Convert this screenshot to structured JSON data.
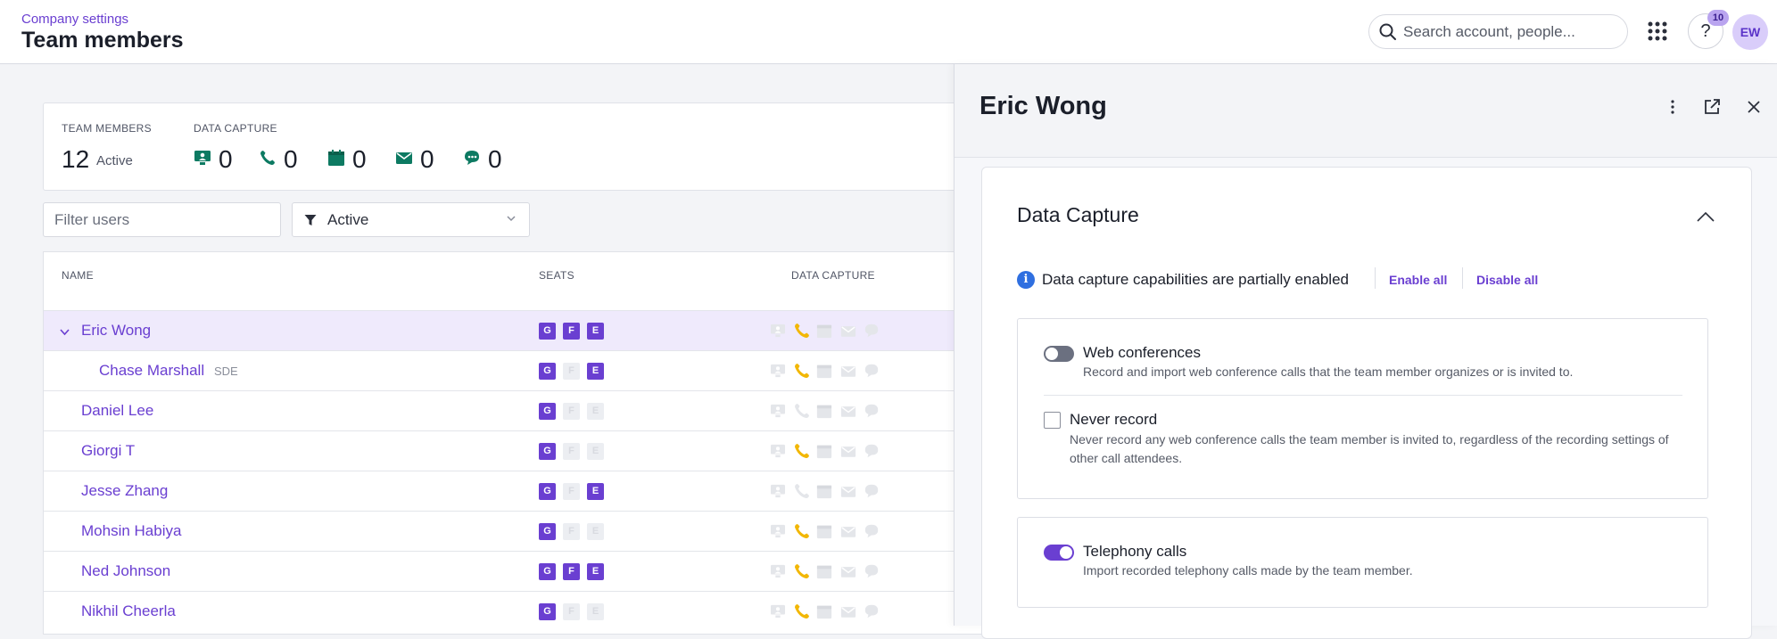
{
  "header": {
    "breadcrumb": "Company settings",
    "title": "Team members",
    "search_placeholder": "Search account, people...",
    "help_label": "?",
    "notification_count": "10",
    "avatar_initials": "EW"
  },
  "summary": {
    "team_members_label": "TEAM MEMBERS",
    "team_members_count": "12",
    "team_members_status": "Active",
    "data_capture_label": "DATA CAPTURE",
    "capture": [
      {
        "icon": "web-conference-icon",
        "count": "0"
      },
      {
        "icon": "phone-icon",
        "count": "0"
      },
      {
        "icon": "calendar-icon",
        "count": "0"
      },
      {
        "icon": "email-icon",
        "count": "0"
      },
      {
        "icon": "chat-icon",
        "count": "0"
      }
    ]
  },
  "filters": {
    "user_placeholder": "Filter users",
    "status_value": "Active"
  },
  "table": {
    "headers": {
      "name": "NAME",
      "seats": "SEATS",
      "data_capture": "DATA CAPTURE"
    },
    "rows": [
      {
        "name": "Eric Wong",
        "sub": "",
        "seats": [
          true,
          true,
          true
        ],
        "phone": true,
        "selected": true
      },
      {
        "name": "Chase Marshall",
        "sub": "SDE",
        "seats": [
          true,
          false,
          true
        ],
        "phone": true,
        "selected": false
      },
      {
        "name": "Daniel Lee",
        "sub": "",
        "seats": [
          true,
          false,
          false
        ],
        "phone": false,
        "selected": false
      },
      {
        "name": "Giorgi T",
        "sub": "",
        "seats": [
          true,
          false,
          false
        ],
        "phone": true,
        "selected": false
      },
      {
        "name": "Jesse Zhang",
        "sub": "",
        "seats": [
          true,
          false,
          true
        ],
        "phone": false,
        "selected": false
      },
      {
        "name": "Mohsin Habiya",
        "sub": "",
        "seats": [
          true,
          false,
          false
        ],
        "phone": true,
        "selected": false
      },
      {
        "name": "Ned Johnson",
        "sub": "",
        "seats": [
          true,
          true,
          true
        ],
        "phone": true,
        "selected": false
      },
      {
        "name": "Nikhil Cheerla",
        "sub": "",
        "seats": [
          true,
          false,
          false
        ],
        "phone": true,
        "selected": false
      }
    ],
    "seat_letters": [
      "G",
      "F",
      "E"
    ]
  },
  "panel": {
    "title": "Eric Wong",
    "section_title": "Data Capture",
    "info_text": "Data capture capabilities are partially enabled",
    "enable_all": "Enable all",
    "disable_all": "Disable all",
    "web_conferences": {
      "title": "Web conferences",
      "description": "Record and import web conference calls that the team member organizes or is invited to.",
      "enabled": false
    },
    "never_record": {
      "title": "Never record",
      "description": "Never record any web conference calls the team member is invited to, regardless of the recording settings of other call attendees.",
      "checked": false
    },
    "telephony": {
      "title": "Telephony calls",
      "description": "Import recorded telephony calls made by the team member.",
      "enabled": true
    }
  },
  "colors": {
    "accent": "#6a3fd1",
    "capture_green": "#0d7a62",
    "phone_active": "#f2b705",
    "info_blue": "#2f6fe0"
  }
}
